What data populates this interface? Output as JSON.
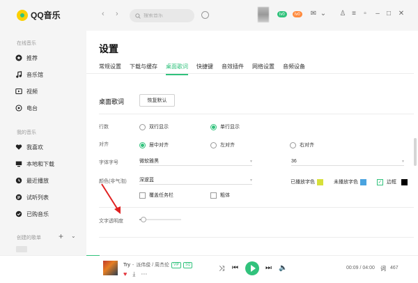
{
  "app": {
    "name": "QQ音乐"
  },
  "sidebar": {
    "online_label": "在线音乐",
    "online_items": [
      {
        "label": "推荐",
        "icon": "star-icon"
      },
      {
        "label": "音乐馆",
        "icon": "music-hall-icon"
      },
      {
        "label": "视频",
        "icon": "video-icon"
      },
      {
        "label": "电台",
        "icon": "radio-icon"
      }
    ],
    "my_label": "我的音乐",
    "my_items": [
      {
        "label": "我喜欢",
        "icon": "heart-icon"
      },
      {
        "label": "本地和下载",
        "icon": "monitor-icon"
      },
      {
        "label": "最近播放",
        "icon": "clock-icon"
      },
      {
        "label": "试听列表",
        "icon": "list-icon"
      },
      {
        "label": "已购音乐",
        "icon": "purchased-icon"
      }
    ],
    "created_label": "创建的歌单",
    "add_symbol": "+",
    "expand_symbol": "⌄"
  },
  "topbar": {
    "search_placeholder": "搜索音乐",
    "vip_badges": [
      "lv0",
      "lv0"
    ],
    "colors": {
      "green_vip": "#31c27c",
      "orange_vip": "#ff8a3d"
    }
  },
  "settings": {
    "title": "设置",
    "tabs": [
      "常规设置",
      "下载与缓存",
      "桌面歌词",
      "快捷键",
      "音效插件",
      "网络设置",
      "音频设备"
    ],
    "active_tab": "桌面歌词",
    "section_title": "桌面歌词",
    "restore_button": "恢复默认",
    "rows_label": "行数",
    "rows_options": [
      "双行显示",
      "单行显示"
    ],
    "align_label": "对齐",
    "align_options": [
      "居中对齐",
      "左对齐",
      "右对齐"
    ],
    "font_label": "字体字号",
    "font_family": "微软雅黑",
    "font_size": "36",
    "color_label": "颜色(非气泡)",
    "color_scheme": "深邃蓝",
    "played_color_label": "已播放字色",
    "unplayed_color_label": "未播放字色",
    "border_label": "边框",
    "swatch_colors": {
      "played": "#d7e03a",
      "unplayed": "#4aa3df",
      "border": "#000000"
    },
    "cover_taskbar_label": "覆盖任务栏",
    "bold_label": "粗体",
    "opacity_label": "文字透明度",
    "opacity_level": 0.1
  },
  "player": {
    "song": "Try",
    "separator": " - ",
    "artist": "派伟俊 / 周杰伦",
    "tags": [
      "VIP",
      "SQ"
    ],
    "time": "00:09 / 04:00",
    "queue_count": "467",
    "progress": 0.04,
    "accent": "#31c27c"
  }
}
